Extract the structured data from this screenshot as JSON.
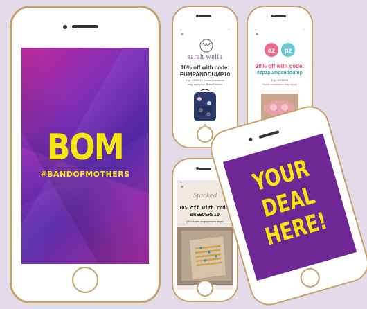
{
  "main_phone": {
    "title": "BOM",
    "tagline": "#BANDOFMOTHERS"
  },
  "sarah_wells": {
    "brand": "sarah wells",
    "offer": "10% off with code:",
    "code": "PUMPANDDUMP10",
    "fine_print": "Exp. 12/31/19 Some exclusions may apply inc. Band Printed"
  },
  "ezpz": {
    "brand": "ezpz",
    "offer": "20% off with code:",
    "code": "ezpzpumpanddump",
    "fine_print_1": "Exp. 12/31/19",
    "fine_print_2": "Some exclusions may apply"
  },
  "stacked": {
    "brand": "Stacked",
    "offer": "10% off with code:",
    "code": "BREEDERS10",
    "fine_print": "(*Excludes engagement rings)"
  },
  "your_deal": {
    "line1": "YOUR",
    "line2": "DEAL",
    "line3": "HERE!"
  },
  "colors": {
    "background": "#e3dbe9",
    "phone_frame": "#c8a06a",
    "accent_yellow": "#f5e60f",
    "deal_purple": "#6f2795",
    "ezpz_code": "#3aa6b8",
    "ezpz_offer": "#d74b6f"
  }
}
